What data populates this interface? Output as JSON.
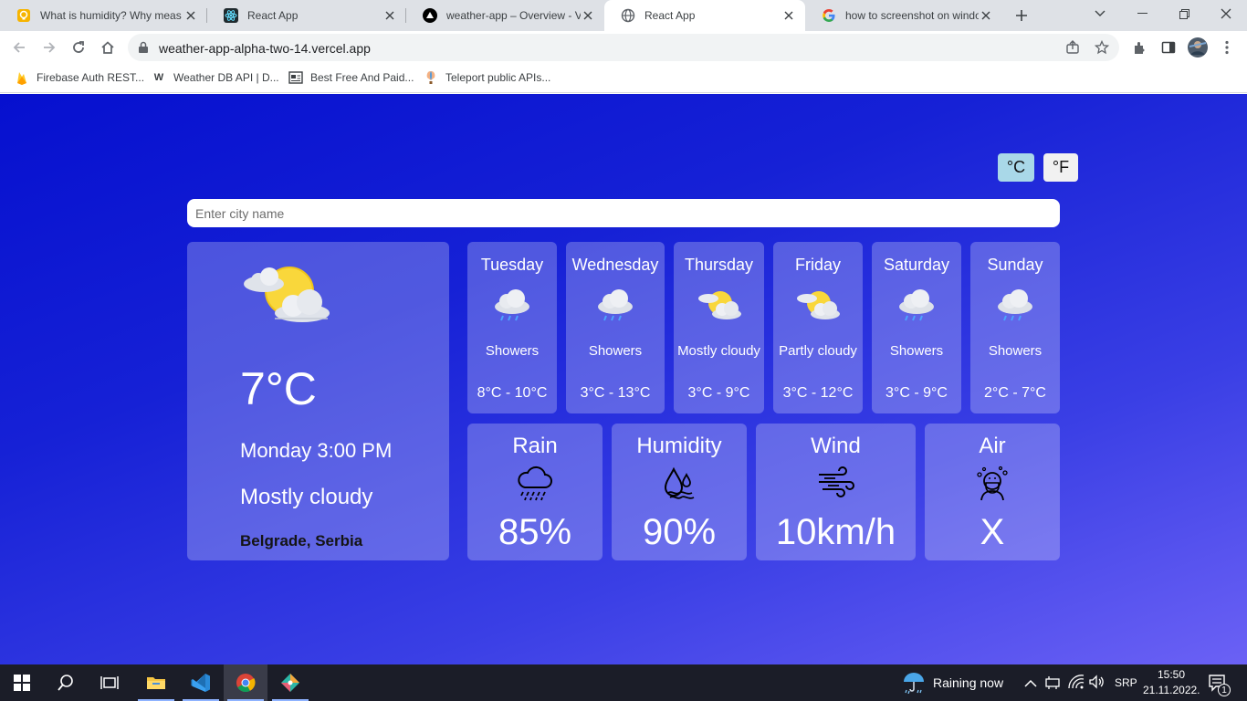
{
  "browser": {
    "tabs": [
      {
        "title": "What is humidity? Why meas",
        "icon": "lightbulb-icon"
      },
      {
        "title": "React App",
        "icon": "react-icon"
      },
      {
        "title": "weather-app – Overview - Ve",
        "icon": "vercel-icon"
      },
      {
        "title": "React App",
        "icon": "globe-icon"
      },
      {
        "title": "how to screenshot on windo",
        "icon": "google-icon"
      }
    ],
    "url": "weather-app-alpha-two-14.vercel.app",
    "bookmarks": [
      {
        "label": "Firebase Auth REST...",
        "icon": "firebase-icon"
      },
      {
        "label": "Weather DB API | D...",
        "icon": "w-icon"
      },
      {
        "label": "Best Free And Paid...",
        "icon": "bookmark-icon"
      },
      {
        "label": "Teleport public APIs...",
        "icon": "balloon-icon"
      }
    ]
  },
  "app": {
    "units": {
      "celsius": "°C",
      "fahrenheit": "°F"
    },
    "search_placeholder": "Enter city name",
    "current": {
      "temp": "7°C",
      "day_time": "Monday 3:00 PM",
      "condition": "Mostly cloudy",
      "location": "Belgrade, Serbia",
      "icon": "partly-cloudy-icon"
    },
    "forecast": [
      {
        "day": "Tuesday",
        "condition": "Showers",
        "range": "8°C - 10°C",
        "icon": "showers-icon"
      },
      {
        "day": "Wednesday",
        "condition": "Showers",
        "range": "3°C - 13°C",
        "icon": "showers-icon"
      },
      {
        "day": "Thursday",
        "condition": "Mostly cloudy",
        "range": "3°C - 9°C",
        "icon": "partly-cloudy-icon"
      },
      {
        "day": "Friday",
        "condition": "Partly cloudy",
        "range": "3°C - 12°C",
        "icon": "partly-cloudy-icon"
      },
      {
        "day": "Saturday",
        "condition": "Showers",
        "range": "3°C - 9°C",
        "icon": "showers-icon"
      },
      {
        "day": "Sunday",
        "condition": "Showers",
        "range": "2°C - 7°C",
        "icon": "showers-icon"
      }
    ],
    "stats": [
      {
        "name": "Rain",
        "value": "85%",
        "icon": "rain-cloud-icon"
      },
      {
        "name": "Humidity",
        "value": "90%",
        "icon": "humidity-icon"
      },
      {
        "name": "Wind",
        "value": "10km/h",
        "icon": "wind-icon"
      },
      {
        "name": "Air",
        "value": "X",
        "icon": "air-quality-icon"
      }
    ]
  },
  "taskbar": {
    "weather": "Raining now",
    "language": "SRP",
    "time": "15:50",
    "date": "21.11.2022.",
    "notifications": "1"
  }
}
